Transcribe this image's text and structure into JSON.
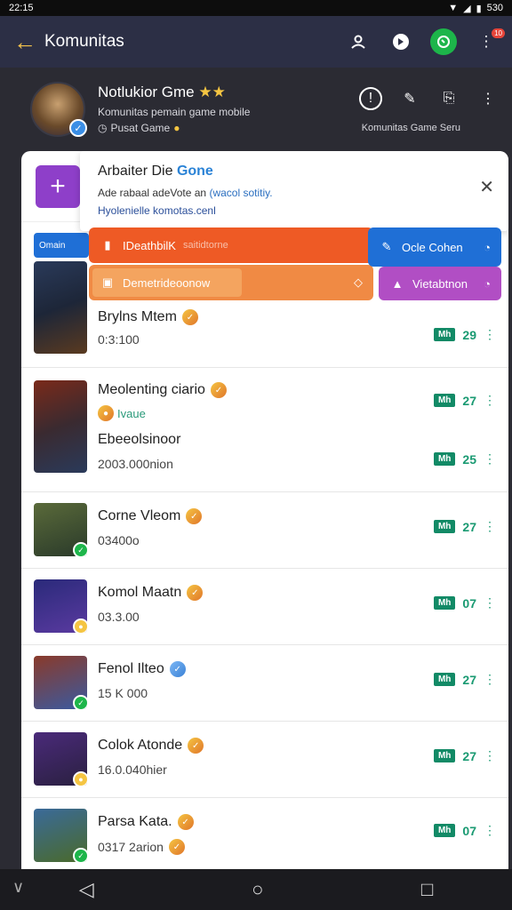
{
  "status": {
    "time": "22:15",
    "battery": "530"
  },
  "appbar": {
    "title": "Komunitas"
  },
  "profile": {
    "name": "Notlukior Gme",
    "subtitle": "Komunitas pemain game mobile",
    "meta": "Pusat Game",
    "tag": "Komunitas Game Seru"
  },
  "popup": {
    "title_a": "Arbaiter Die",
    "title_b": "Gone",
    "line1_a": "Ade rabaal adeVote an",
    "line1_b": "(wacol sotitiy.",
    "line2": "Hyolenielle komotas.cenl"
  },
  "cards": {
    "orange1": {
      "label": "IDeathbilK",
      "faint": "saitidtorne"
    },
    "orange2": {
      "label": "Demetrideoonow",
      "faint": ""
    },
    "blue": {
      "label": "Ocle Cohen"
    },
    "purple": {
      "label": "Vietabtnon"
    },
    "chip": {
      "label": "Omain"
    }
  },
  "list": [
    {
      "name": "Brylns Mtem",
      "sub": "0:3:100",
      "stats": [
        {
          "pill": "Mh",
          "num": "29"
        }
      ]
    },
    {
      "name": "Meolenting ciario",
      "tag": "Ivaue",
      "sub2": "Ebeeolsinoor",
      "sub": "2003.000nion",
      "stats": [
        {
          "pill": "Mh",
          "num": "27"
        },
        {
          "pill": "Mh",
          "num": "25"
        }
      ]
    },
    {
      "name": "Corne Vleom",
      "sub": "03400o",
      "stats": [
        {
          "pill": "Mh",
          "num": "27"
        }
      ]
    },
    {
      "name": "Komol Maatn",
      "sub": "03.3.00",
      "stats": [
        {
          "pill": "Mh",
          "num": "07"
        }
      ]
    },
    {
      "name": "Fenol Ilteo",
      "sub": "15 K 000",
      "stats": [
        {
          "pill": "Mh",
          "num": "27"
        }
      ]
    },
    {
      "name": "Colok Atonde",
      "sub": "16.0.040hier",
      "stats": [
        {
          "pill": "Mh",
          "num": "27"
        }
      ]
    },
    {
      "name": "Parsa Kata.",
      "sub": "0317 2arion",
      "stats": [
        {
          "pill": "Mh",
          "num": "07"
        }
      ]
    }
  ]
}
